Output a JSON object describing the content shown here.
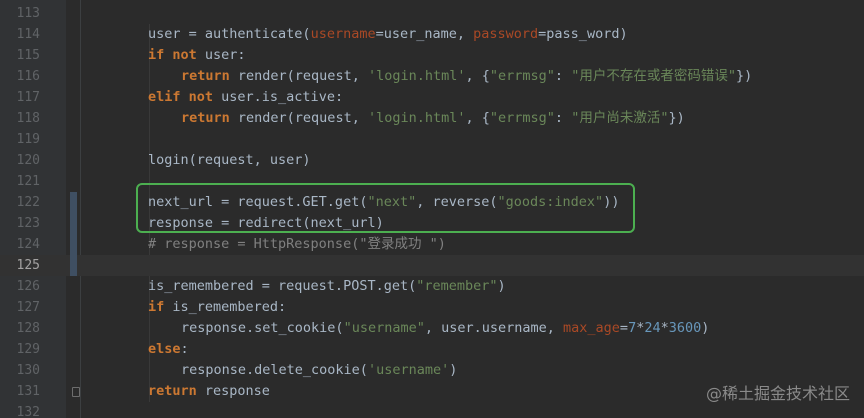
{
  "editor": {
    "lines": [
      {
        "n": "113",
        "indent": 0,
        "tokens": []
      },
      {
        "n": "114",
        "indent": 1,
        "tokens": [
          {
            "t": "user = authenticate(",
            "c": "plain"
          },
          {
            "t": "username",
            "c": "param"
          },
          {
            "t": "=user_name, ",
            "c": "plain"
          },
          {
            "t": "password",
            "c": "param"
          },
          {
            "t": "=pass_word)",
            "c": "plain"
          }
        ]
      },
      {
        "n": "115",
        "indent": 1,
        "tokens": [
          {
            "t": "if not ",
            "c": "kw"
          },
          {
            "t": "user:",
            "c": "plain"
          }
        ]
      },
      {
        "n": "116",
        "indent": 2,
        "tokens": [
          {
            "t": "return ",
            "c": "kw"
          },
          {
            "t": "render(request, ",
            "c": "plain"
          },
          {
            "t": "'login.html'",
            "c": "str"
          },
          {
            "t": ", {",
            "c": "plain"
          },
          {
            "t": "\"errmsg\"",
            "c": "str"
          },
          {
            "t": ": ",
            "c": "plain"
          },
          {
            "t": "\"用户不存在或者密码错误\"",
            "c": "str"
          },
          {
            "t": "})",
            "c": "plain"
          }
        ]
      },
      {
        "n": "117",
        "indent": 1,
        "tokens": [
          {
            "t": "elif not ",
            "c": "kw"
          },
          {
            "t": "user.is_active:",
            "c": "plain"
          }
        ]
      },
      {
        "n": "118",
        "indent": 2,
        "tokens": [
          {
            "t": "return ",
            "c": "kw"
          },
          {
            "t": "render(request, ",
            "c": "plain"
          },
          {
            "t": "'login.html'",
            "c": "str"
          },
          {
            "t": ", {",
            "c": "plain"
          },
          {
            "t": "\"errmsg\"",
            "c": "str"
          },
          {
            "t": ": ",
            "c": "plain"
          },
          {
            "t": "\"用户尚未激活\"",
            "c": "str"
          },
          {
            "t": "})",
            "c": "plain"
          }
        ]
      },
      {
        "n": "119",
        "indent": 0,
        "tokens": []
      },
      {
        "n": "120",
        "indent": 1,
        "tokens": [
          {
            "t": "login(request, user)",
            "c": "plain"
          }
        ]
      },
      {
        "n": "121",
        "indent": 0,
        "tokens": []
      },
      {
        "n": "122",
        "indent": 1,
        "tokens": [
          {
            "t": "next_url = request.GET.get(",
            "c": "plain"
          },
          {
            "t": "\"next\"",
            "c": "str"
          },
          {
            "t": ", reverse(",
            "c": "plain"
          },
          {
            "t": "\"goods:index\"",
            "c": "str"
          },
          {
            "t": "))",
            "c": "plain"
          }
        ]
      },
      {
        "n": "123",
        "indent": 1,
        "tokens": [
          {
            "t": "response = redirect(next_url)",
            "c": "plain"
          }
        ]
      },
      {
        "n": "124",
        "indent": 1,
        "tokens": [
          {
            "t": "# response = HttpResponse(\"登录成功 \")",
            "c": "cmt"
          }
        ]
      },
      {
        "n": "125",
        "indent": 0,
        "tokens": [],
        "current": true
      },
      {
        "n": "126",
        "indent": 1,
        "tokens": [
          {
            "t": "is_remembered = request.POST.get(",
            "c": "plain"
          },
          {
            "t": "\"remember\"",
            "c": "str"
          },
          {
            "t": ")",
            "c": "plain"
          }
        ]
      },
      {
        "n": "127",
        "indent": 1,
        "tokens": [
          {
            "t": "if ",
            "c": "kw"
          },
          {
            "t": "is_remembered:",
            "c": "plain"
          }
        ]
      },
      {
        "n": "128",
        "indent": 2,
        "tokens": [
          {
            "t": "response.set_cookie(",
            "c": "plain"
          },
          {
            "t": "\"username\"",
            "c": "str"
          },
          {
            "t": ", user.username, ",
            "c": "plain"
          },
          {
            "t": "max_age",
            "c": "param"
          },
          {
            "t": "=",
            "c": "plain"
          },
          {
            "t": "7",
            "c": "num"
          },
          {
            "t": "*",
            "c": "plain"
          },
          {
            "t": "24",
            "c": "num"
          },
          {
            "t": "*",
            "c": "plain"
          },
          {
            "t": "3600",
            "c": "num"
          },
          {
            "t": ")",
            "c": "plain"
          }
        ]
      },
      {
        "n": "129",
        "indent": 1,
        "tokens": [
          {
            "t": "else",
            "c": "kw"
          },
          {
            "t": ":",
            "c": "plain"
          }
        ]
      },
      {
        "n": "130",
        "indent": 2,
        "tokens": [
          {
            "t": "response.delete_cookie(",
            "c": "plain"
          },
          {
            "t": "'username'",
            "c": "str"
          },
          {
            "t": ")",
            "c": "plain"
          }
        ]
      },
      {
        "n": "131",
        "indent": 1,
        "tokens": [
          {
            "t": "return ",
            "c": "kw"
          },
          {
            "t": "response",
            "c": "plain"
          }
        ]
      },
      {
        "n": "132",
        "indent": 0,
        "tokens": []
      }
    ]
  },
  "watermark": "@稀土掘金技术社区",
  "colors": {
    "background": "#2b2b2b",
    "gutter": "#313335",
    "keyword": "#cc7832",
    "string": "#6a8759",
    "parameter": "#aa4926",
    "number": "#6897bb",
    "comment": "#808080",
    "text": "#a9b7c6",
    "highlight_box": "#4caf50"
  }
}
